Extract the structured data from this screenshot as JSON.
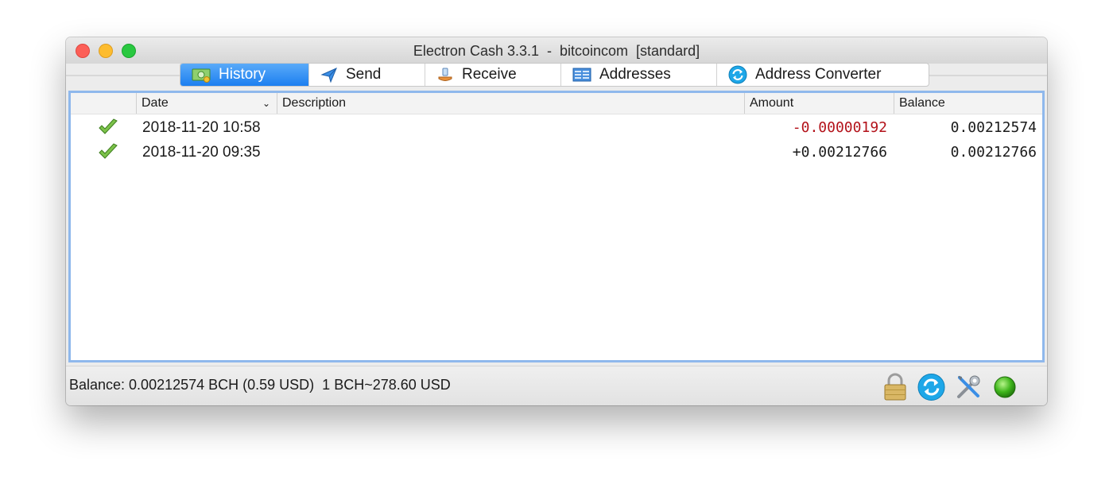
{
  "window": {
    "title": "Electron Cash 3.3.1  -  bitcoincom  [standard]"
  },
  "tabs": [
    {
      "label": "History",
      "icon": "history-icon",
      "active": true
    },
    {
      "label": "Send",
      "icon": "send-icon",
      "active": false
    },
    {
      "label": "Receive",
      "icon": "receive-icon",
      "active": false
    },
    {
      "label": "Addresses",
      "icon": "addresses-icon",
      "active": false
    },
    {
      "label": "Address Converter",
      "icon": "address-converter-icon",
      "active": false
    }
  ],
  "history": {
    "columns": {
      "status": "",
      "date": "Date",
      "description": "Description",
      "amount": "Amount",
      "balance": "Balance"
    },
    "sort_indicator": "⌄",
    "rows": [
      {
        "status": "confirmed-checkmark-icon",
        "date": "2018-11-20 10:58",
        "description": "",
        "amount": "-0.00000192",
        "balance": "0.00212574"
      },
      {
        "status": "confirmed-checkmark-icon",
        "date": "2018-11-20 09:35",
        "description": "",
        "amount": "+0.00212766",
        "balance": "0.00212766"
      }
    ]
  },
  "statusbar": {
    "text": "Balance: 0.00212574 BCH (0.59 USD)  1 BCH~278.60 USD",
    "icons": [
      "lock-icon",
      "sync-icon",
      "preferences-tools-icon",
      "network-status-icon"
    ]
  },
  "colors": {
    "tab_active_top": "#5aaaf8",
    "tab_active_bottom": "#1c7ff0",
    "negative_amount": "#b3121a",
    "panel_border": "#8fb8ec",
    "network_ok": "#3fb51c"
  }
}
